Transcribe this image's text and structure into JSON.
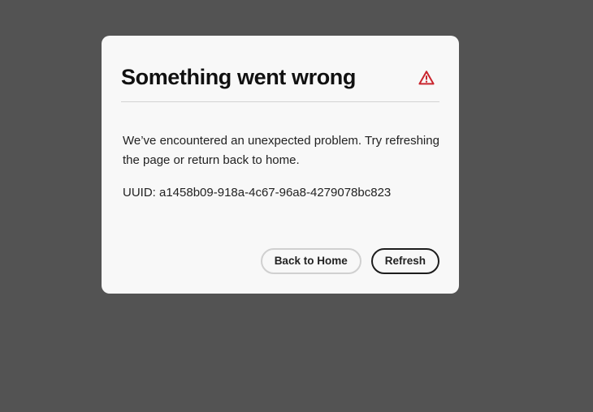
{
  "dialog": {
    "title": "Something went wrong",
    "alert_icon": "alert-triangle-icon",
    "message": "We’ve encountered an unexpected problem. Try refreshing the page or return back to home.",
    "uuid_text": "UUID: a1458b09-918a-4c67-96a8-4279078bc823",
    "buttons": {
      "back_home_label": "Back to Home",
      "refresh_label": "Refresh"
    }
  },
  "colors": {
    "backdrop": "#535353",
    "dialog_background": "#f8f8f8",
    "alert_icon": "#c9252d",
    "text": "#222222"
  }
}
